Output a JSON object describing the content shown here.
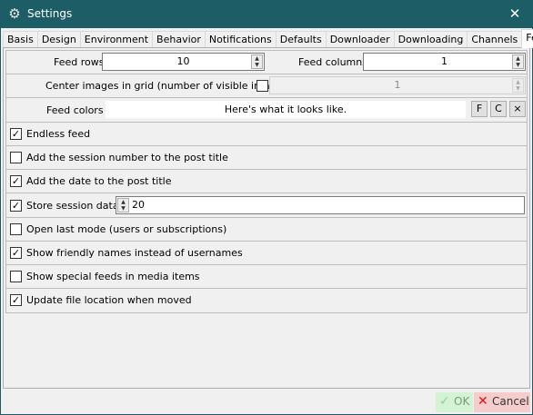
{
  "window": {
    "title": "Settings",
    "icon": "gear-icon",
    "close_glyph": "✕"
  },
  "tabs": [
    "Basis",
    "Design",
    "Environment",
    "Behavior",
    "Notifications",
    "Defaults",
    "Downloader",
    "Downloading",
    "Channels",
    "Feed"
  ],
  "active_tab": "Feed",
  "feed": {
    "feed_rows_label": "Feed rows",
    "feed_rows_value": "10",
    "feed_columns_label": "Feed columns",
    "feed_columns_value": "1",
    "center_images_label": "Center images in grid (number of visible images)",
    "center_images_value": "1",
    "feed_colors_label": "Feed colors",
    "feed_colors_preview": "Here's what it looks like.",
    "color_buttons": [
      "F",
      "C",
      "×"
    ],
    "checkboxes": {
      "endless_feed": "Endless feed",
      "add_session_number": "Add the session number to the post title",
      "add_date": "Add the date to the post title",
      "store_session_data": "Store session data",
      "store_session_value": "20",
      "open_last_mode": "Open last mode (users or subscriptions)",
      "friendly_names": "Show friendly names instead of usernames",
      "special_feeds": "Show special feeds in media items",
      "update_file_location": "Update file location when moved"
    }
  },
  "buttons": {
    "ok": "OK",
    "cancel": "Cancel"
  },
  "colors": {
    "titlebar": "#1d5d66",
    "ok_bg": "#d4f2d4",
    "cancel_bg": "#f6cdcd"
  }
}
